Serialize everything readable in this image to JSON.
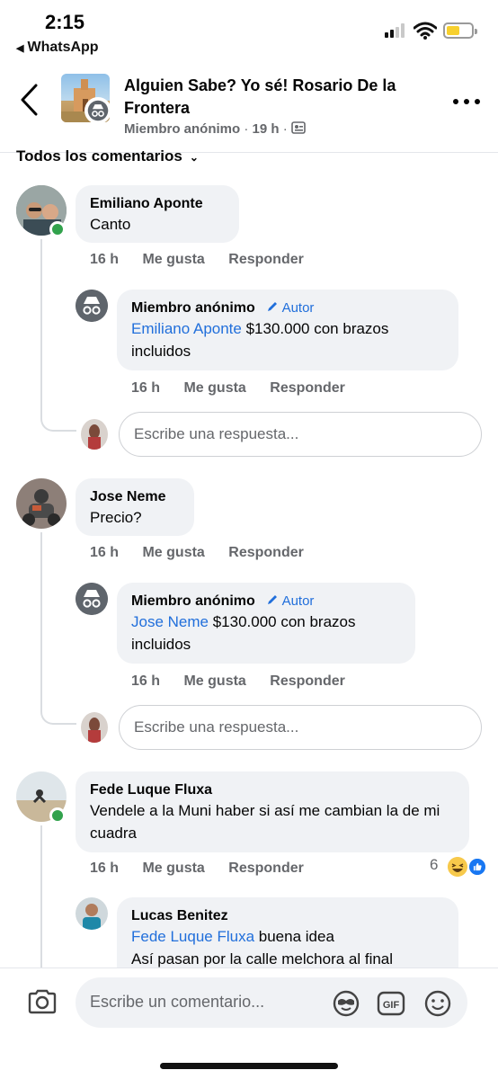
{
  "status_bar": {
    "time": "2:15",
    "back_app": "WhatsApp",
    "battery_color": "#f7d02e"
  },
  "header": {
    "title": "Alguien Sabe? Yo sé! Rosario De la Frontera",
    "subtitle_author": "Miembro anónimo",
    "subtitle_time": "19 h",
    "back_icon": "chevron-left-icon",
    "more_icon": "more-horizontal-icon"
  },
  "filter_label": "Todos los comentarios",
  "actions": {
    "like": "Me gusta",
    "reply": "Responder"
  },
  "reply_placeholder": "Escribe una respuesta...",
  "comments": [
    {
      "author": "Emiliano Aponte",
      "text": "Canto",
      "time": "16 h",
      "online": true,
      "reply": {
        "author": "Miembro anónimo",
        "badge": "Autor",
        "mention": "Emiliano Aponte",
        "text": " $130.000 con brazos incluidos",
        "time": "16 h"
      }
    },
    {
      "author": "Jose Neme",
      "text": "Precio?",
      "time": "16 h",
      "online": false,
      "reply": {
        "author": "Miembro anónimo",
        "badge": "Autor",
        "mention": "Jose Neme",
        "text": " $130.000 con brazos incluidos",
        "time": "16 h"
      }
    },
    {
      "author": "Fede Luque Fluxa",
      "text": "Vendele a la Muni haber si así me cambian la de mi cuadra",
      "time": "16 h",
      "online": true,
      "reaction_count": "6",
      "reactions": [
        "haha-icon",
        "like-icon"
      ],
      "reply": {
        "author": "Lucas Benitez",
        "mention": "Fede Luque Fluxa",
        "text": " buena idea",
        "text2": "Así pasan por la calle melchora al final"
      }
    }
  ],
  "composer": {
    "placeholder": "Escribe un comentario...",
    "icons": [
      "camera-icon",
      "avatar-sticker-icon",
      "gif-icon",
      "emoji-icon"
    ]
  },
  "colors": {
    "link": "#216fdb",
    "bubble": "#f0f2f5",
    "meta": "#65676b",
    "online": "#31a24c"
  }
}
